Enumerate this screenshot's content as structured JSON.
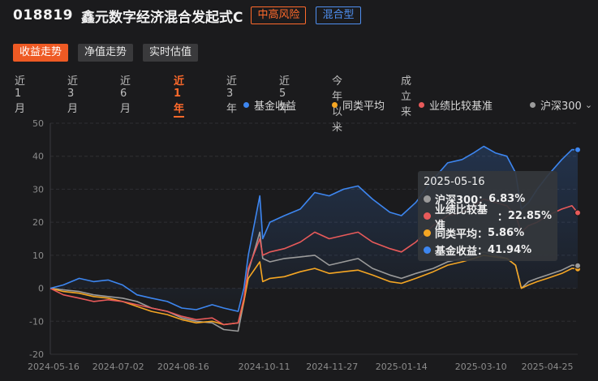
{
  "header": {
    "fund_code": "018819",
    "fund_name": "鑫元数字经济混合发起式C",
    "risk_tag": "中高风险",
    "type_tag": "混合型"
  },
  "view_tabs": [
    {
      "label": "收益走势",
      "active": true
    },
    {
      "label": "净值走势",
      "active": false
    },
    {
      "label": "实时估值",
      "active": false
    }
  ],
  "period_tabs": [
    {
      "label": "近1月",
      "active": false
    },
    {
      "label": "近3月",
      "active": false
    },
    {
      "label": "近6月",
      "active": false
    },
    {
      "label": "近1年",
      "active": true
    },
    {
      "label": "近3年",
      "active": false
    },
    {
      "label": "近5年",
      "active": false
    },
    {
      "label": "今年以来",
      "active": false
    },
    {
      "label": "成立来",
      "active": false
    }
  ],
  "legend": [
    {
      "label": "基金收益",
      "color": "#3d86f0"
    },
    {
      "label": "同类平均",
      "color": "#f5a623"
    },
    {
      "label": "业绩比较基准",
      "color": "#e85a5a"
    },
    {
      "label": "沪深300",
      "color": "#9b9b9b",
      "has_dropdown": true
    }
  ],
  "tooltip": {
    "date": "2025-05-16",
    "rows": [
      {
        "label": "沪深300",
        "value": "6.83%",
        "color": "#9b9b9b"
      },
      {
        "label": "业绩比较基准",
        "value": "22.85%",
        "color": "#e85a5a"
      },
      {
        "label": "同类平均",
        "value": "5.86%",
        "color": "#f5a623"
      },
      {
        "label": "基金收益",
        "value": "41.94%",
        "color": "#3d86f0"
      }
    ]
  },
  "chart_data": {
    "type": "line",
    "ylim": [
      -20,
      50
    ],
    "yticks": [
      50,
      40,
      30,
      20,
      10,
      0,
      -10,
      -20
    ],
    "xlim": [
      "2024-05-16",
      "2025-05-16"
    ],
    "xticks": [
      "2024-05-16",
      "2024-07-02",
      "2024-08-16",
      "2024-10-11",
      "2024-11-27",
      "2025-01-14",
      "2025-03-10",
      "2025-04-25"
    ],
    "grid": true,
    "series": [
      {
        "name": "基金收益",
        "color": "#3d86f0",
        "points": [
          [
            "2024-05-16",
            0
          ],
          [
            "2024-05-25",
            1
          ],
          [
            "2024-06-05",
            3
          ],
          [
            "2024-06-15",
            2
          ],
          [
            "2024-06-25",
            2.5
          ],
          [
            "2024-07-05",
            1
          ],
          [
            "2024-07-15",
            -2
          ],
          [
            "2024-07-25",
            -3
          ],
          [
            "2024-08-05",
            -4
          ],
          [
            "2024-08-15",
            -6
          ],
          [
            "2024-08-25",
            -6.5
          ],
          [
            "2024-09-05",
            -5
          ],
          [
            "2024-09-13",
            -6
          ],
          [
            "2024-09-23",
            -7
          ],
          [
            "2024-09-27",
            0
          ],
          [
            "2024-09-30",
            10
          ],
          [
            "2024-10-08",
            28
          ],
          [
            "2024-10-10",
            15
          ],
          [
            "2024-10-15",
            20
          ],
          [
            "2024-10-25",
            22
          ],
          [
            "2024-11-05",
            24
          ],
          [
            "2024-11-15",
            29
          ],
          [
            "2024-11-25",
            28
          ],
          [
            "2024-12-05",
            30
          ],
          [
            "2024-12-15",
            31
          ],
          [
            "2024-12-25",
            27
          ],
          [
            "2025-01-06",
            23
          ],
          [
            "2025-01-14",
            22
          ],
          [
            "2025-01-24",
            26
          ],
          [
            "2025-02-05",
            33
          ],
          [
            "2025-02-15",
            38
          ],
          [
            "2025-02-25",
            39
          ],
          [
            "2025-03-05",
            41
          ],
          [
            "2025-03-12",
            43
          ],
          [
            "2025-03-20",
            41
          ],
          [
            "2025-03-28",
            40
          ],
          [
            "2025-04-03",
            35
          ],
          [
            "2025-04-07",
            24
          ],
          [
            "2025-04-12",
            26
          ],
          [
            "2025-04-18",
            30
          ],
          [
            "2025-04-25",
            34
          ],
          [
            "2025-05-05",
            39
          ],
          [
            "2025-05-12",
            42
          ],
          [
            "2025-05-16",
            41.94
          ]
        ]
      },
      {
        "name": "同类平均",
        "color": "#f5a623",
        "points": [
          [
            "2024-05-16",
            0
          ],
          [
            "2024-05-25",
            -1
          ],
          [
            "2024-06-05",
            -1.5
          ],
          [
            "2024-06-15",
            -2.5
          ],
          [
            "2024-06-25",
            -3
          ],
          [
            "2024-07-05",
            -4
          ],
          [
            "2024-07-15",
            -5.5
          ],
          [
            "2024-07-25",
            -7
          ],
          [
            "2024-08-05",
            -8
          ],
          [
            "2024-08-15",
            -9.5
          ],
          [
            "2024-08-25",
            -10.5
          ],
          [
            "2024-09-05",
            -10
          ],
          [
            "2024-09-13",
            -11
          ],
          [
            "2024-09-23",
            -10.5
          ],
          [
            "2024-09-27",
            -4
          ],
          [
            "2024-09-30",
            3
          ],
          [
            "2024-10-08",
            8
          ],
          [
            "2024-10-10",
            2
          ],
          [
            "2024-10-15",
            3
          ],
          [
            "2024-10-25",
            3.5
          ],
          [
            "2024-11-05",
            5
          ],
          [
            "2024-11-15",
            6
          ],
          [
            "2024-11-25",
            4.5
          ],
          [
            "2024-12-05",
            5
          ],
          [
            "2024-12-15",
            5.5
          ],
          [
            "2024-12-25",
            4
          ],
          [
            "2025-01-06",
            2
          ],
          [
            "2025-01-14",
            1.5
          ],
          [
            "2025-01-24",
            3
          ],
          [
            "2025-02-05",
            5
          ],
          [
            "2025-02-15",
            7
          ],
          [
            "2025-02-25",
            8
          ],
          [
            "2025-03-05",
            9
          ],
          [
            "2025-03-12",
            10
          ],
          [
            "2025-03-20",
            9.5
          ],
          [
            "2025-03-28",
            9
          ],
          [
            "2025-04-03",
            7
          ],
          [
            "2025-04-07",
            0
          ],
          [
            "2025-04-12",
            1
          ],
          [
            "2025-04-18",
            2
          ],
          [
            "2025-04-25",
            3
          ],
          [
            "2025-05-05",
            4.5
          ],
          [
            "2025-05-12",
            6
          ],
          [
            "2025-05-16",
            5.86
          ]
        ]
      },
      {
        "name": "业绩比较基准",
        "color": "#e85a5a",
        "points": [
          [
            "2024-05-16",
            0
          ],
          [
            "2024-05-25",
            -2
          ],
          [
            "2024-06-05",
            -3
          ],
          [
            "2024-06-15",
            -4
          ],
          [
            "2024-06-25",
            -3.5
          ],
          [
            "2024-07-05",
            -4
          ],
          [
            "2024-07-15",
            -5
          ],
          [
            "2024-07-25",
            -6
          ],
          [
            "2024-08-05",
            -7
          ],
          [
            "2024-08-15",
            -8.5
          ],
          [
            "2024-08-25",
            -9.5
          ],
          [
            "2024-09-05",
            -9
          ],
          [
            "2024-09-13",
            -11
          ],
          [
            "2024-09-23",
            -10.5
          ],
          [
            "2024-09-27",
            -3
          ],
          [
            "2024-09-30",
            6
          ],
          [
            "2024-10-08",
            15
          ],
          [
            "2024-10-10",
            10
          ],
          [
            "2024-10-15",
            11
          ],
          [
            "2024-10-25",
            12
          ],
          [
            "2024-11-05",
            14
          ],
          [
            "2024-11-15",
            17
          ],
          [
            "2024-11-25",
            15
          ],
          [
            "2024-12-05",
            16
          ],
          [
            "2024-12-15",
            17
          ],
          [
            "2024-12-25",
            14
          ],
          [
            "2025-01-06",
            12
          ],
          [
            "2025-01-14",
            11
          ],
          [
            "2025-01-24",
            14
          ],
          [
            "2025-02-05",
            19
          ],
          [
            "2025-02-15",
            22
          ],
          [
            "2025-02-25",
            23
          ],
          [
            "2025-03-05",
            25
          ],
          [
            "2025-03-12",
            27
          ],
          [
            "2025-03-20",
            26
          ],
          [
            "2025-03-28",
            25
          ],
          [
            "2025-04-03",
            22
          ],
          [
            "2025-04-07",
            17
          ],
          [
            "2025-04-12",
            19
          ],
          [
            "2025-04-18",
            20
          ],
          [
            "2025-04-25",
            22
          ],
          [
            "2025-05-05",
            24
          ],
          [
            "2025-05-12",
            25
          ],
          [
            "2025-05-16",
            22.85
          ]
        ]
      },
      {
        "name": "沪深300",
        "color": "#9b9b9b",
        "points": [
          [
            "2024-05-16",
            0
          ],
          [
            "2024-05-25",
            -0.5
          ],
          [
            "2024-06-05",
            -1
          ],
          [
            "2024-06-15",
            -2
          ],
          [
            "2024-06-25",
            -2.5
          ],
          [
            "2024-07-05",
            -3
          ],
          [
            "2024-07-15",
            -4
          ],
          [
            "2024-07-25",
            -6
          ],
          [
            "2024-08-05",
            -7
          ],
          [
            "2024-08-15",
            -9
          ],
          [
            "2024-08-25",
            -10
          ],
          [
            "2024-09-05",
            -10.5
          ],
          [
            "2024-09-13",
            -12.5
          ],
          [
            "2024-09-23",
            -13
          ],
          [
            "2024-09-27",
            -4
          ],
          [
            "2024-09-30",
            5
          ],
          [
            "2024-10-08",
            17
          ],
          [
            "2024-10-10",
            9
          ],
          [
            "2024-10-15",
            8
          ],
          [
            "2024-10-25",
            9
          ],
          [
            "2024-11-05",
            9.5
          ],
          [
            "2024-11-15",
            10
          ],
          [
            "2024-11-25",
            7
          ],
          [
            "2024-12-05",
            8
          ],
          [
            "2024-12-15",
            9
          ],
          [
            "2024-12-25",
            6
          ],
          [
            "2025-01-06",
            4
          ],
          [
            "2025-01-14",
            3
          ],
          [
            "2025-01-24",
            4.5
          ],
          [
            "2025-02-05",
            6
          ],
          [
            "2025-02-15",
            8
          ],
          [
            "2025-02-25",
            9
          ],
          [
            "2025-03-05",
            10
          ],
          [
            "2025-03-12",
            11
          ],
          [
            "2025-03-20",
            10
          ],
          [
            "2025-03-28",
            9
          ],
          [
            "2025-04-03",
            7
          ],
          [
            "2025-04-07",
            0
          ],
          [
            "2025-04-12",
            2
          ],
          [
            "2025-04-18",
            3
          ],
          [
            "2025-04-25",
            4
          ],
          [
            "2025-05-05",
            5.5
          ],
          [
            "2025-05-12",
            7
          ],
          [
            "2025-05-16",
            6.83
          ]
        ]
      }
    ]
  }
}
